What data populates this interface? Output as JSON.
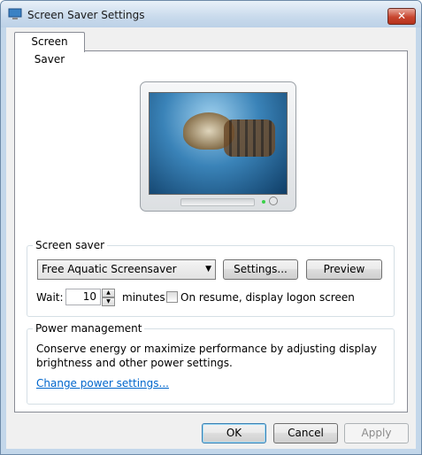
{
  "window": {
    "title": "Screen Saver Settings",
    "close_glyph": "✕"
  },
  "tabs": [
    {
      "label": "Screen Saver"
    }
  ],
  "screen_saver_group": {
    "legend": "Screen saver",
    "selected_saver": "Free Aquatic Screensaver",
    "settings_label": "Settings...",
    "preview_label": "Preview",
    "wait_label": "Wait:",
    "wait_value": "10",
    "minutes_label": "minutes",
    "resume_label": "On resume, display logon screen",
    "resume_checked": false
  },
  "power_group": {
    "legend": "Power management",
    "description_line1": "Conserve energy or maximize performance by adjusting display",
    "description_line2": "brightness and other power settings.",
    "link_label": "Change power settings..."
  },
  "footer": {
    "ok_label": "OK",
    "cancel_label": "Cancel",
    "apply_label": "Apply"
  }
}
